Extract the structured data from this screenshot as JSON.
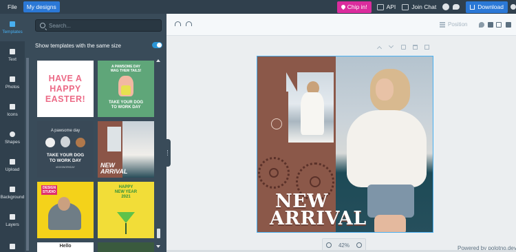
{
  "topbar": {
    "file_label": "File",
    "my_designs_label": "My designs",
    "chip_in_label": "Chip in!",
    "api_label": "API",
    "join_chat_label": "Join Chat",
    "download_label": "Download"
  },
  "sidetabs": [
    {
      "label": "Templates",
      "icon": "templates-icon",
      "active": true
    },
    {
      "label": "Text",
      "icon": "text-icon"
    },
    {
      "label": "Photos",
      "icon": "photos-icon"
    },
    {
      "label": "Icons",
      "icon": "icons-icon"
    },
    {
      "label": "Shapes",
      "icon": "shapes-icon"
    },
    {
      "label": "Upload",
      "icon": "upload-icon"
    },
    {
      "label": "Background",
      "icon": "background-icon"
    },
    {
      "label": "Layers",
      "icon": "layers-icon"
    },
    {
      "label": "",
      "icon": "resize-icon"
    }
  ],
  "panel": {
    "search_placeholder": "Search...",
    "same_size_label": "Show templates with the same size",
    "same_size_enabled": true,
    "templates": {
      "easter_text": "HAVE A\nHAPPY\nEASTER!",
      "dog_green_top": "A PAWSOME DAY\nWAG THEM TAILS!",
      "dog_green_bottom": "TAKE YOUR DOG\nTO WORK DAY",
      "dog_dark_top": "A pawsome day",
      "dog_dark_bottom": "TAKE YOUR DOG\nTO WORK DAY",
      "dog_dark_sub": "#DOGWORKDAY",
      "arrival_text": "NEW\nARRIVAL",
      "studio_text": "DESIGN\nSTUDIO",
      "newyear_text": "HAPPY\nNEW YEAR\n2021",
      "bottom_text": "Hello"
    }
  },
  "workspace": {
    "position_label": "Position",
    "canvas_text_line1": "NEW",
    "canvas_text_line2": "ARRIVAL",
    "zoom_label": "42%",
    "powered_by": "Powered by polotno.dev"
  },
  "colors": {
    "accent": "#2b78d6",
    "chip_in": "#db2c9d",
    "canvas_bg": "#8b5849"
  }
}
